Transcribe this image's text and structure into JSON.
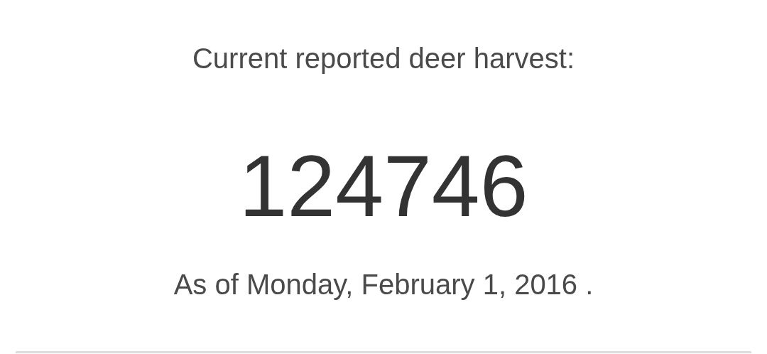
{
  "heading": "Current reported deer harvest:",
  "count": "124746",
  "date": "As of Monday, February 1, 2016 ."
}
